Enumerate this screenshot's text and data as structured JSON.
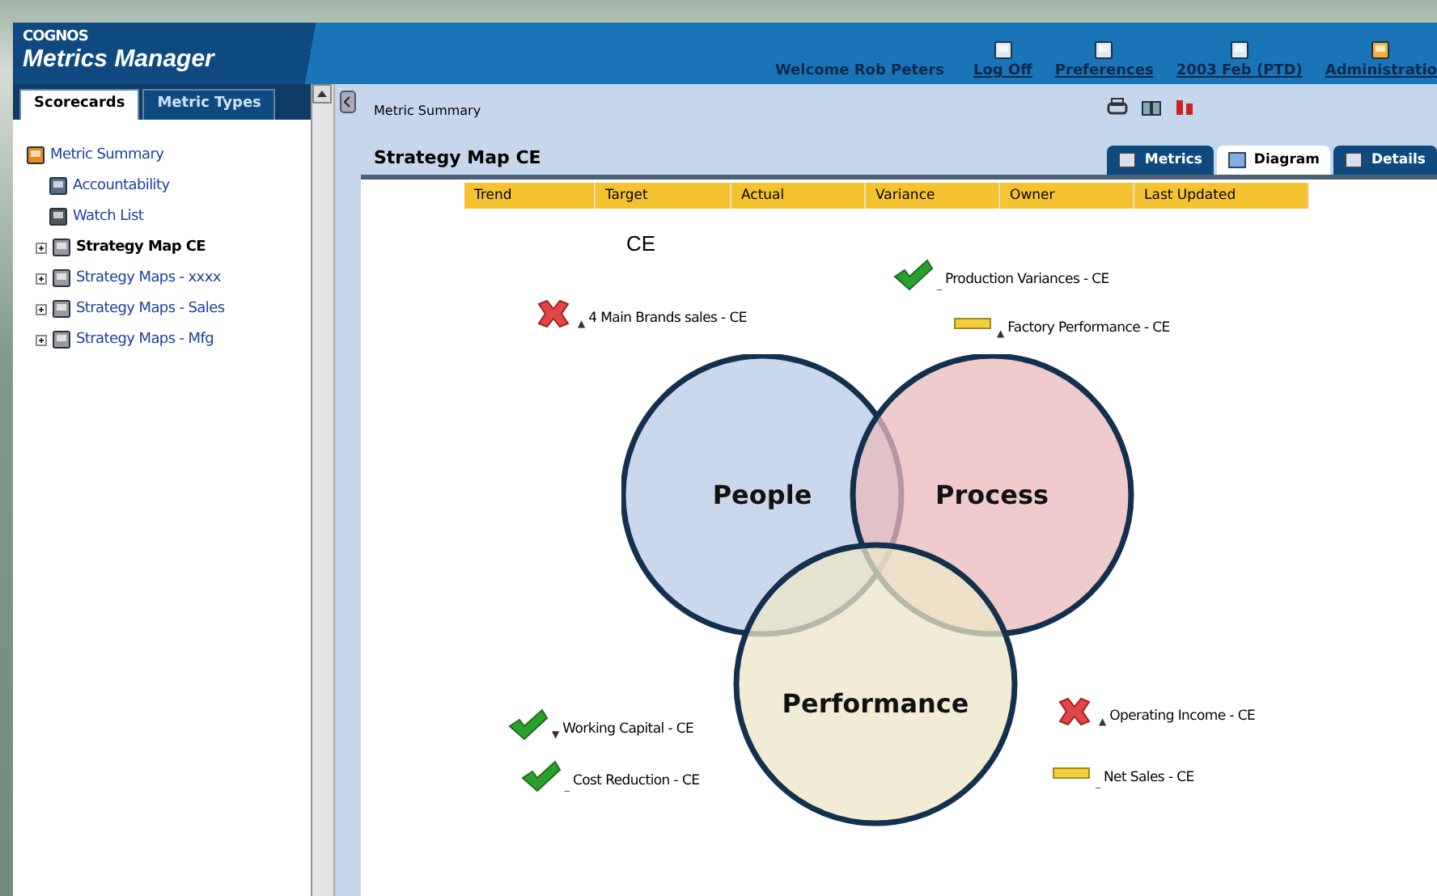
{
  "header": {
    "product_brand": "COGNOS",
    "product_name": "Metrics Manager",
    "welcome": "Welcome Rob Peters",
    "links": [
      {
        "label": "Log Off",
        "kind": "user"
      },
      {
        "label": "Preferences",
        "kind": "prefs"
      },
      {
        "label": "2003 Feb (PTD)",
        "kind": "period"
      },
      {
        "label": "Administratio",
        "kind": "admin"
      }
    ]
  },
  "sidebar": {
    "tabs": [
      {
        "label": "Scorecards",
        "selected": true
      },
      {
        "label": "Metric Types",
        "selected": false
      }
    ],
    "tree": [
      {
        "label": "Metric Summary",
        "kind": "summary",
        "selected": false,
        "children": [
          {
            "label": "Accountability",
            "kind": "person",
            "selected": false
          },
          {
            "label": "Watch List",
            "kind": "watch",
            "selected": false
          },
          {
            "label": "Strategy Map CE",
            "kind": "map",
            "expandable": true,
            "selected": true
          },
          {
            "label": "Strategy Maps - xxxx",
            "kind": "map",
            "expandable": true,
            "selected": false
          },
          {
            "label": "Strategy Maps - Sales",
            "kind": "map",
            "expandable": true,
            "selected": false
          },
          {
            "label": "Strategy Maps - Mfg",
            "kind": "map",
            "expandable": true,
            "selected": false
          }
        ]
      }
    ]
  },
  "main": {
    "breadcrumb": "Metric Summary",
    "title": "Strategy Map CE",
    "tabs": [
      {
        "label": "Metrics",
        "selected": false
      },
      {
        "label": "Diagram",
        "selected": true
      },
      {
        "label": "Details",
        "selected": false
      }
    ],
    "columns": [
      "Trend",
      "Target",
      "Actual",
      "Variance",
      "Owner",
      "Last Updated"
    ],
    "diagram": {
      "title": "CE",
      "circles": [
        {
          "label": "People",
          "color": "#b8cbe6"
        },
        {
          "label": "Process",
          "color": "#e9b9be"
        },
        {
          "label": "Performance",
          "color": "#ede6c6"
        }
      ],
      "metrics": [
        {
          "label": "Production Variances - CE",
          "kind": "good",
          "trend": "_"
        },
        {
          "label": "4 Main Brands sales - CE",
          "kind": "bad",
          "trend": "▲"
        },
        {
          "label": "Factory Performance - CE",
          "kind": "neutral",
          "trend": "▲"
        },
        {
          "label": "Working Capital - CE",
          "kind": "good",
          "trend": "▼"
        },
        {
          "label": "Cost Reduction - CE",
          "kind": "good",
          "trend": "_"
        },
        {
          "label": "Operating Income - CE",
          "kind": "bad",
          "trend": "▲"
        },
        {
          "label": "Net Sales - CE",
          "kind": "neutral",
          "trend": "_"
        }
      ]
    }
  }
}
